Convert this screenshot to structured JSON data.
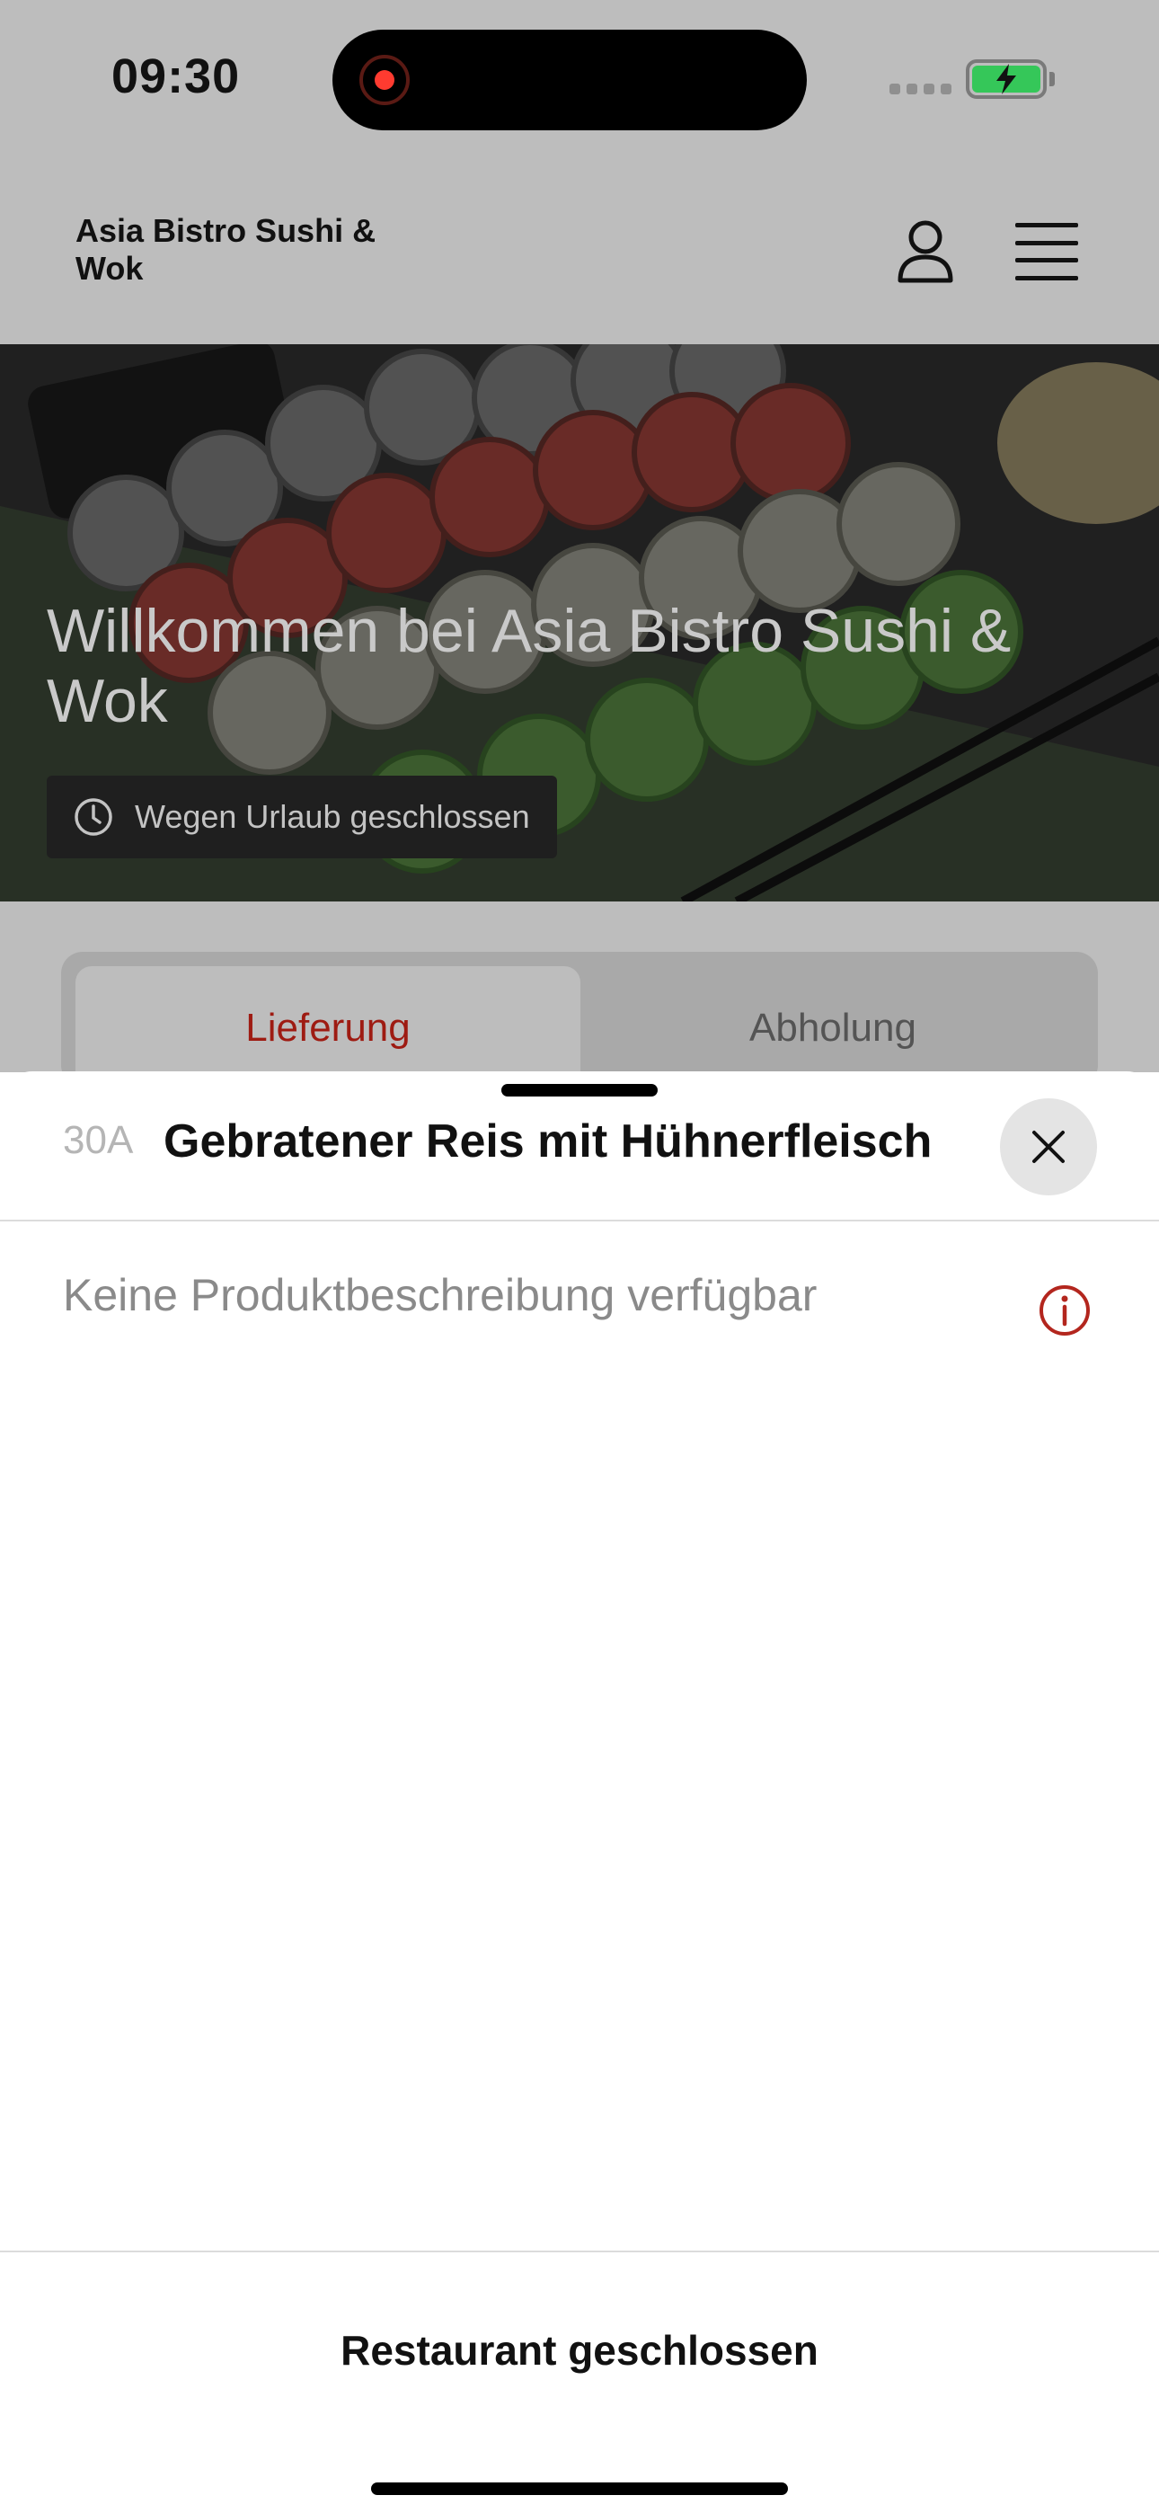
{
  "status_bar": {
    "time": "09:30"
  },
  "header": {
    "app_name": "Asia Bistro Sushi & Wok",
    "icons": [
      "account-icon",
      "hamburger-menu-icon"
    ]
  },
  "hero": {
    "title": "Willkommen bei Asia Bistro Sushi & Wok",
    "status": "Wegen Urlaub geschlossen",
    "status_icon": "clock-icon"
  },
  "order_mode_tabs": {
    "items": [
      {
        "label": "Lieferung",
        "selected": true
      },
      {
        "label": "Abholung",
        "selected": false
      }
    ]
  },
  "product_sheet": {
    "number": "30A",
    "title": "Gebratener Reis mit Hühnerfleisch",
    "description": "Keine Produktbeschreibung verfügbar",
    "close_icon": "close-icon",
    "info_icon": "info-icon"
  },
  "footer": {
    "label": "Restaurant geschlossen"
  },
  "colors": {
    "accent": "#9e1b12",
    "dim_overlay": "#bdbdbd",
    "battery": "#35c759",
    "record": "#ff3b30"
  }
}
